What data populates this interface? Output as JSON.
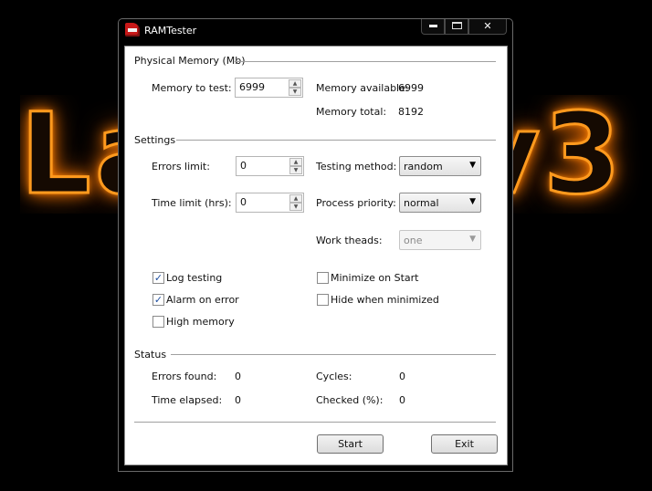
{
  "window": {
    "title": "RAMTester",
    "controls": {
      "minimize": "minimize",
      "maximize": "maximize",
      "close": "✕"
    }
  },
  "background": {
    "text_left": "La",
    "text_right": "v3"
  },
  "physical_memory": {
    "heading": "Physical Memory (Mb)",
    "to_test_label": "Memory to test:",
    "to_test_value": "6999",
    "available_label": "Memory available:",
    "available_value": "6999",
    "total_label": "Memory total:",
    "total_value": "8192"
  },
  "settings": {
    "heading": "Settings",
    "errors_limit_label": "Errors limit:",
    "errors_limit_value": "0",
    "time_limit_label": "Time limit (hrs):",
    "time_limit_value": "0",
    "testing_method_label": "Testing method:",
    "testing_method_value": "random",
    "process_priority_label": "Process priority:",
    "process_priority_value": "normal",
    "work_threads_label": "Work theads:",
    "work_threads_value": "one",
    "checkboxes": {
      "log_testing": {
        "label": "Log testing",
        "checked": true
      },
      "alarm_on_error": {
        "label": "Alarm on error",
        "checked": true
      },
      "high_memory": {
        "label": "High memory",
        "checked": false
      },
      "minimize_on_start": {
        "label": "Minimize on Start",
        "checked": false
      },
      "hide_when_minimized": {
        "label": "Hide when minimized",
        "checked": false
      }
    }
  },
  "status": {
    "heading": "Status",
    "errors_found_label": "Errors found:",
    "errors_found_value": "0",
    "time_elapsed_label": "Time elapsed:",
    "time_elapsed_value": "0",
    "cycles_label": "Cycles:",
    "cycles_value": "0",
    "checked_label": "Checked (%):",
    "checked_value": "0"
  },
  "buttons": {
    "start": "Start",
    "exit": "Exit"
  },
  "colors": {
    "glow": "#ff9a1e",
    "background": "#000000",
    "client": "#ffffff"
  }
}
